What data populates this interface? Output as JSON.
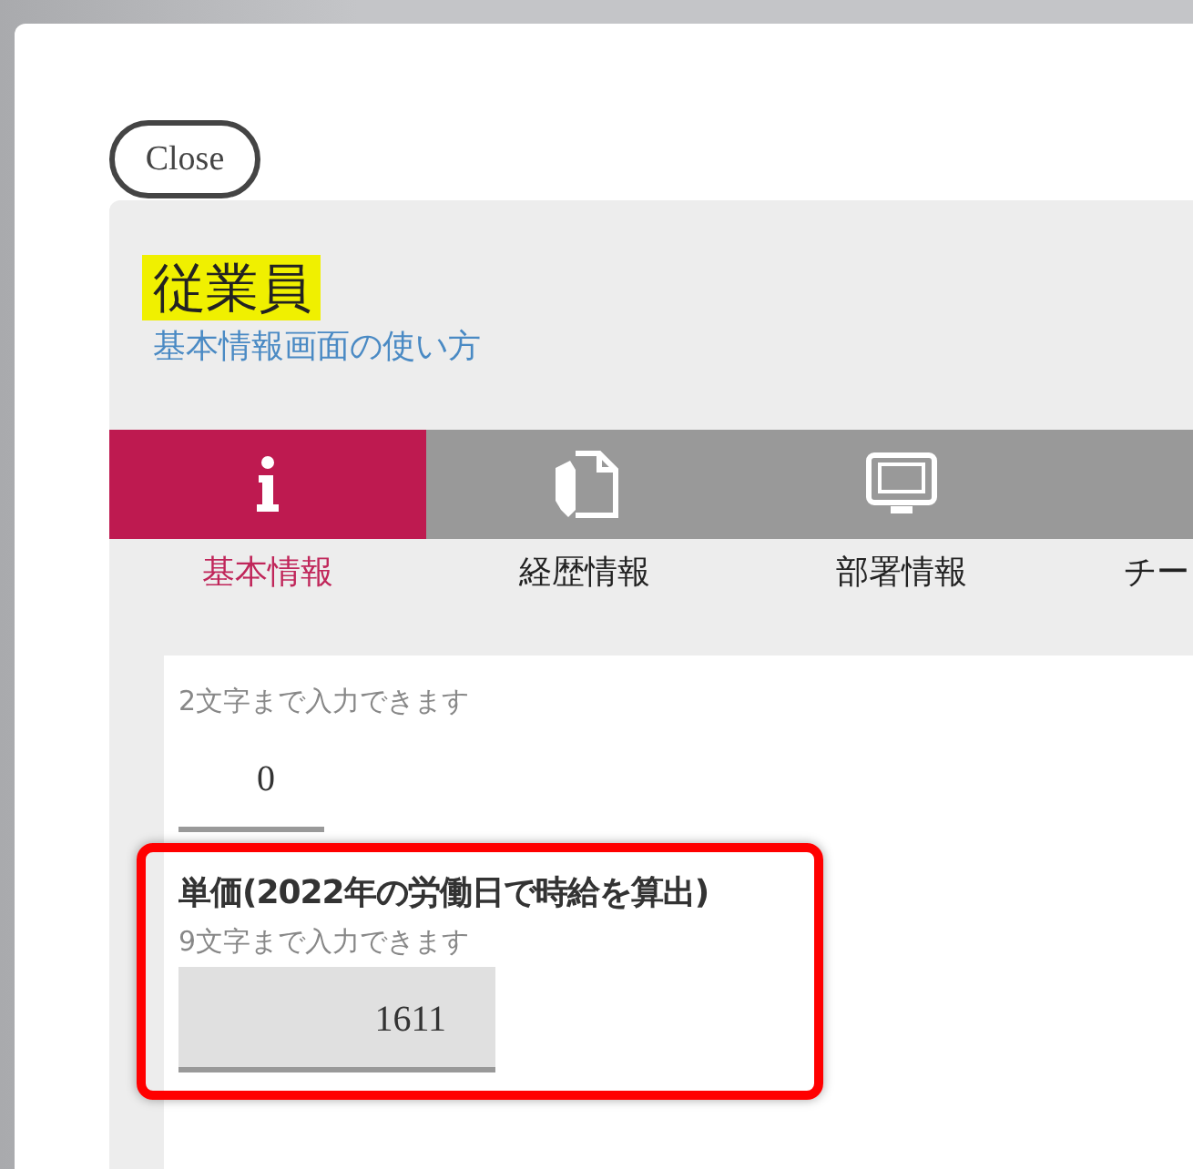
{
  "close_button": {
    "label": "Close"
  },
  "title": "従業員",
  "help_link": "基本情報画面の使い方",
  "tabs": [
    {
      "label": "基本情報",
      "selected": true
    },
    {
      "label": "経歴情報",
      "selected": false
    },
    {
      "label": "部署情報",
      "selected": false
    },
    {
      "label": "チー",
      "selected": false
    }
  ],
  "fields": [
    {
      "hint": "2文字まで入力できます",
      "value": "0",
      "readonly": false,
      "highlighted": false
    },
    {
      "label": "単価(2022年の労働日で時給を算出)",
      "hint": "9文字まで入力できます",
      "value": "1611",
      "readonly": true,
      "highlighted": true
    }
  ]
}
